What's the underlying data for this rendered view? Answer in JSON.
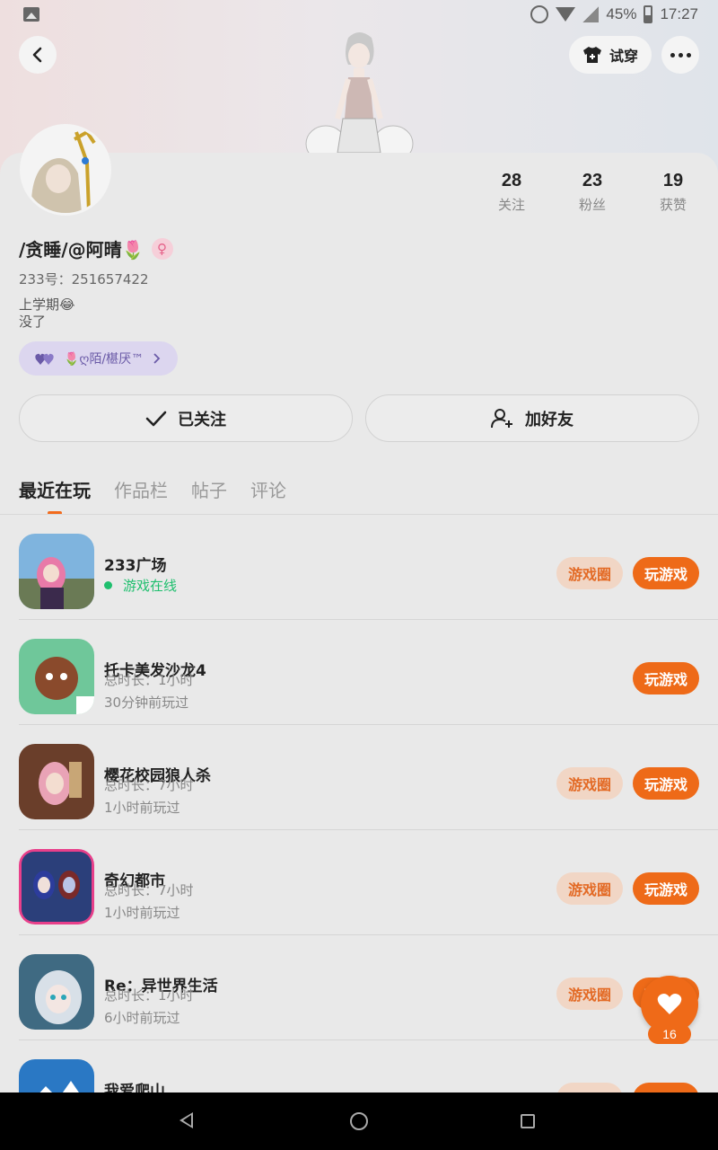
{
  "status_bar": {
    "battery": "45%",
    "time": "17:27"
  },
  "header": {
    "try_on_label": "试穿"
  },
  "profile": {
    "nickname": "/贪睡/@阿晴🌷",
    "gender_symbol": "♀",
    "uid": "233号：251657422",
    "bio_line1": "上学期😂",
    "bio_line2": "没了",
    "family_tag": "🌷ღ陌/椹厌™",
    "stats": [
      {
        "value": "28",
        "label": "关注"
      },
      {
        "value": "23",
        "label": "粉丝"
      },
      {
        "value": "19",
        "label": "获赞"
      }
    ],
    "follow_label": "已关注",
    "add_friend_label": "加好友"
  },
  "tabs": [
    "最近在玩",
    "作品栏",
    "帖子",
    "评论"
  ],
  "games": [
    {
      "name": "233广场",
      "line1": "游戏在线",
      "line2": "",
      "online": true,
      "circle": true
    },
    {
      "name": "托卡美发沙龙4",
      "line1": "总时长：1小时",
      "line2": "30分钟前玩过",
      "online": false,
      "circle": false
    },
    {
      "name": "樱花校园狼人杀",
      "line1": "总时长：7小时",
      "line2": "1小时前玩过",
      "online": false,
      "circle": true
    },
    {
      "name": "奇幻都市",
      "line1": "总时长：7小时",
      "line2": "1小时前玩过",
      "online": false,
      "circle": true
    },
    {
      "name": "Re：异世界生活",
      "line1": "总时长：1小时",
      "line2": "6小时前玩过",
      "online": false,
      "circle": true
    },
    {
      "name": "我爱爬山",
      "line1": "",
      "line2": "",
      "online": false,
      "circle": true
    }
  ],
  "buttons": {
    "circle_label": "游戏圈",
    "play_label": "玩游戏"
  },
  "like_float": {
    "count": "16"
  },
  "colors": {
    "accent": "#ee6a18",
    "online": "#1fbf6e"
  }
}
